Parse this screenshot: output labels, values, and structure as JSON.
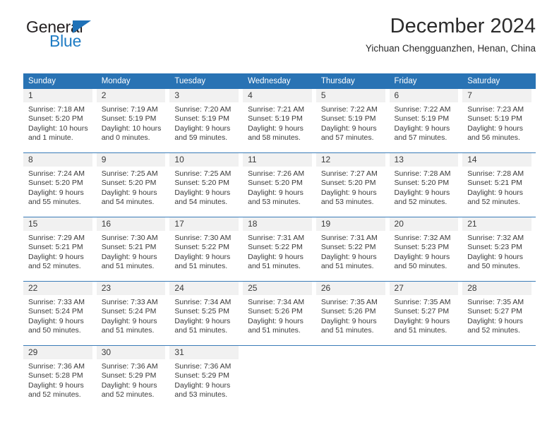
{
  "logo": {
    "word_top": "General",
    "word_bottom": "Blue",
    "triangle_icon": "blue-triangle-icon",
    "accent_color": "#1f7cc4"
  },
  "header": {
    "title": "December 2024",
    "subtitle": "Yichuan Chengguanzhen, Henan, China"
  },
  "calendar": {
    "header_color": "#2973b4",
    "weekday_headers": [
      "Sunday",
      "Monday",
      "Tuesday",
      "Wednesday",
      "Thursday",
      "Friday",
      "Saturday"
    ],
    "weeks": [
      [
        {
          "day": "1",
          "sunrise": "Sunrise: 7:18 AM",
          "sunset": "Sunset: 5:20 PM",
          "daylight1": "Daylight: 10 hours",
          "daylight2": "and 1 minute."
        },
        {
          "day": "2",
          "sunrise": "Sunrise: 7:19 AM",
          "sunset": "Sunset: 5:19 PM",
          "daylight1": "Daylight: 10 hours",
          "daylight2": "and 0 minutes."
        },
        {
          "day": "3",
          "sunrise": "Sunrise: 7:20 AM",
          "sunset": "Sunset: 5:19 PM",
          "daylight1": "Daylight: 9 hours",
          "daylight2": "and 59 minutes."
        },
        {
          "day": "4",
          "sunrise": "Sunrise: 7:21 AM",
          "sunset": "Sunset: 5:19 PM",
          "daylight1": "Daylight: 9 hours",
          "daylight2": "and 58 minutes."
        },
        {
          "day": "5",
          "sunrise": "Sunrise: 7:22 AM",
          "sunset": "Sunset: 5:19 PM",
          "daylight1": "Daylight: 9 hours",
          "daylight2": "and 57 minutes."
        },
        {
          "day": "6",
          "sunrise": "Sunrise: 7:22 AM",
          "sunset": "Sunset: 5:19 PM",
          "daylight1": "Daylight: 9 hours",
          "daylight2": "and 57 minutes."
        },
        {
          "day": "7",
          "sunrise": "Sunrise: 7:23 AM",
          "sunset": "Sunset: 5:19 PM",
          "daylight1": "Daylight: 9 hours",
          "daylight2": "and 56 minutes."
        }
      ],
      [
        {
          "day": "8",
          "sunrise": "Sunrise: 7:24 AM",
          "sunset": "Sunset: 5:20 PM",
          "daylight1": "Daylight: 9 hours",
          "daylight2": "and 55 minutes."
        },
        {
          "day": "9",
          "sunrise": "Sunrise: 7:25 AM",
          "sunset": "Sunset: 5:20 PM",
          "daylight1": "Daylight: 9 hours",
          "daylight2": "and 54 minutes."
        },
        {
          "day": "10",
          "sunrise": "Sunrise: 7:25 AM",
          "sunset": "Sunset: 5:20 PM",
          "daylight1": "Daylight: 9 hours",
          "daylight2": "and 54 minutes."
        },
        {
          "day": "11",
          "sunrise": "Sunrise: 7:26 AM",
          "sunset": "Sunset: 5:20 PM",
          "daylight1": "Daylight: 9 hours",
          "daylight2": "and 53 minutes."
        },
        {
          "day": "12",
          "sunrise": "Sunrise: 7:27 AM",
          "sunset": "Sunset: 5:20 PM",
          "daylight1": "Daylight: 9 hours",
          "daylight2": "and 53 minutes."
        },
        {
          "day": "13",
          "sunrise": "Sunrise: 7:28 AM",
          "sunset": "Sunset: 5:20 PM",
          "daylight1": "Daylight: 9 hours",
          "daylight2": "and 52 minutes."
        },
        {
          "day": "14",
          "sunrise": "Sunrise: 7:28 AM",
          "sunset": "Sunset: 5:21 PM",
          "daylight1": "Daylight: 9 hours",
          "daylight2": "and 52 minutes."
        }
      ],
      [
        {
          "day": "15",
          "sunrise": "Sunrise: 7:29 AM",
          "sunset": "Sunset: 5:21 PM",
          "daylight1": "Daylight: 9 hours",
          "daylight2": "and 52 minutes."
        },
        {
          "day": "16",
          "sunrise": "Sunrise: 7:30 AM",
          "sunset": "Sunset: 5:21 PM",
          "daylight1": "Daylight: 9 hours",
          "daylight2": "and 51 minutes."
        },
        {
          "day": "17",
          "sunrise": "Sunrise: 7:30 AM",
          "sunset": "Sunset: 5:22 PM",
          "daylight1": "Daylight: 9 hours",
          "daylight2": "and 51 minutes."
        },
        {
          "day": "18",
          "sunrise": "Sunrise: 7:31 AM",
          "sunset": "Sunset: 5:22 PM",
          "daylight1": "Daylight: 9 hours",
          "daylight2": "and 51 minutes."
        },
        {
          "day": "19",
          "sunrise": "Sunrise: 7:31 AM",
          "sunset": "Sunset: 5:22 PM",
          "daylight1": "Daylight: 9 hours",
          "daylight2": "and 51 minutes."
        },
        {
          "day": "20",
          "sunrise": "Sunrise: 7:32 AM",
          "sunset": "Sunset: 5:23 PM",
          "daylight1": "Daylight: 9 hours",
          "daylight2": "and 50 minutes."
        },
        {
          "day": "21",
          "sunrise": "Sunrise: 7:32 AM",
          "sunset": "Sunset: 5:23 PM",
          "daylight1": "Daylight: 9 hours",
          "daylight2": "and 50 minutes."
        }
      ],
      [
        {
          "day": "22",
          "sunrise": "Sunrise: 7:33 AM",
          "sunset": "Sunset: 5:24 PM",
          "daylight1": "Daylight: 9 hours",
          "daylight2": "and 50 minutes."
        },
        {
          "day": "23",
          "sunrise": "Sunrise: 7:33 AM",
          "sunset": "Sunset: 5:24 PM",
          "daylight1": "Daylight: 9 hours",
          "daylight2": "and 51 minutes."
        },
        {
          "day": "24",
          "sunrise": "Sunrise: 7:34 AM",
          "sunset": "Sunset: 5:25 PM",
          "daylight1": "Daylight: 9 hours",
          "daylight2": "and 51 minutes."
        },
        {
          "day": "25",
          "sunrise": "Sunrise: 7:34 AM",
          "sunset": "Sunset: 5:26 PM",
          "daylight1": "Daylight: 9 hours",
          "daylight2": "and 51 minutes."
        },
        {
          "day": "26",
          "sunrise": "Sunrise: 7:35 AM",
          "sunset": "Sunset: 5:26 PM",
          "daylight1": "Daylight: 9 hours",
          "daylight2": "and 51 minutes."
        },
        {
          "day": "27",
          "sunrise": "Sunrise: 7:35 AM",
          "sunset": "Sunset: 5:27 PM",
          "daylight1": "Daylight: 9 hours",
          "daylight2": "and 51 minutes."
        },
        {
          "day": "28",
          "sunrise": "Sunrise: 7:35 AM",
          "sunset": "Sunset: 5:27 PM",
          "daylight1": "Daylight: 9 hours",
          "daylight2": "and 52 minutes."
        }
      ],
      [
        {
          "day": "29",
          "sunrise": "Sunrise: 7:36 AM",
          "sunset": "Sunset: 5:28 PM",
          "daylight1": "Daylight: 9 hours",
          "daylight2": "and 52 minutes."
        },
        {
          "day": "30",
          "sunrise": "Sunrise: 7:36 AM",
          "sunset": "Sunset: 5:29 PM",
          "daylight1": "Daylight: 9 hours",
          "daylight2": "and 52 minutes."
        },
        {
          "day": "31",
          "sunrise": "Sunrise: 7:36 AM",
          "sunset": "Sunset: 5:29 PM",
          "daylight1": "Daylight: 9 hours",
          "daylight2": "and 53 minutes."
        },
        {
          "day": "",
          "sunrise": "",
          "sunset": "",
          "daylight1": "",
          "daylight2": ""
        },
        {
          "day": "",
          "sunrise": "",
          "sunset": "",
          "daylight1": "",
          "daylight2": ""
        },
        {
          "day": "",
          "sunrise": "",
          "sunset": "",
          "daylight1": "",
          "daylight2": ""
        },
        {
          "day": "",
          "sunrise": "",
          "sunset": "",
          "daylight1": "",
          "daylight2": ""
        }
      ]
    ]
  }
}
